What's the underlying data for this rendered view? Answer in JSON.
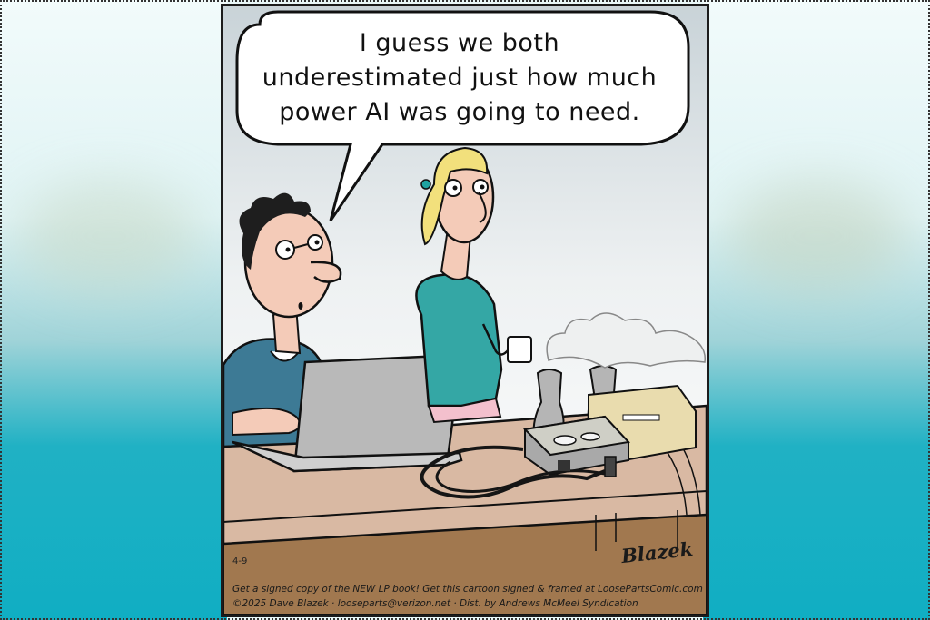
{
  "comic": {
    "speech": [
      "I guess we both",
      "underestimated just how much",
      "power AI was going to need."
    ],
    "date_code": "4-9",
    "signature": "Blazek",
    "credit_line_1": "Get a signed copy of the NEW LP book! Get this cartoon signed & framed at LoosePartsComic.com",
    "credit_line_2": "©2025 Dave Blazek · looseparts@verizon.net · Dist. by Andrews McMeel Syndication"
  },
  "colors": {
    "sky": "#dfe6ea",
    "wall": "#ffffff",
    "desk_top": "#d9b9a3",
    "desk_side": "#a1784f",
    "man_shirt": "#3d7a95",
    "woman_shirt": "#34a7a5",
    "skin": "#f4cbb8",
    "laptop": "#b9b9b9",
    "plant": "#e9dcae",
    "background_teal": "#10aec3"
  }
}
